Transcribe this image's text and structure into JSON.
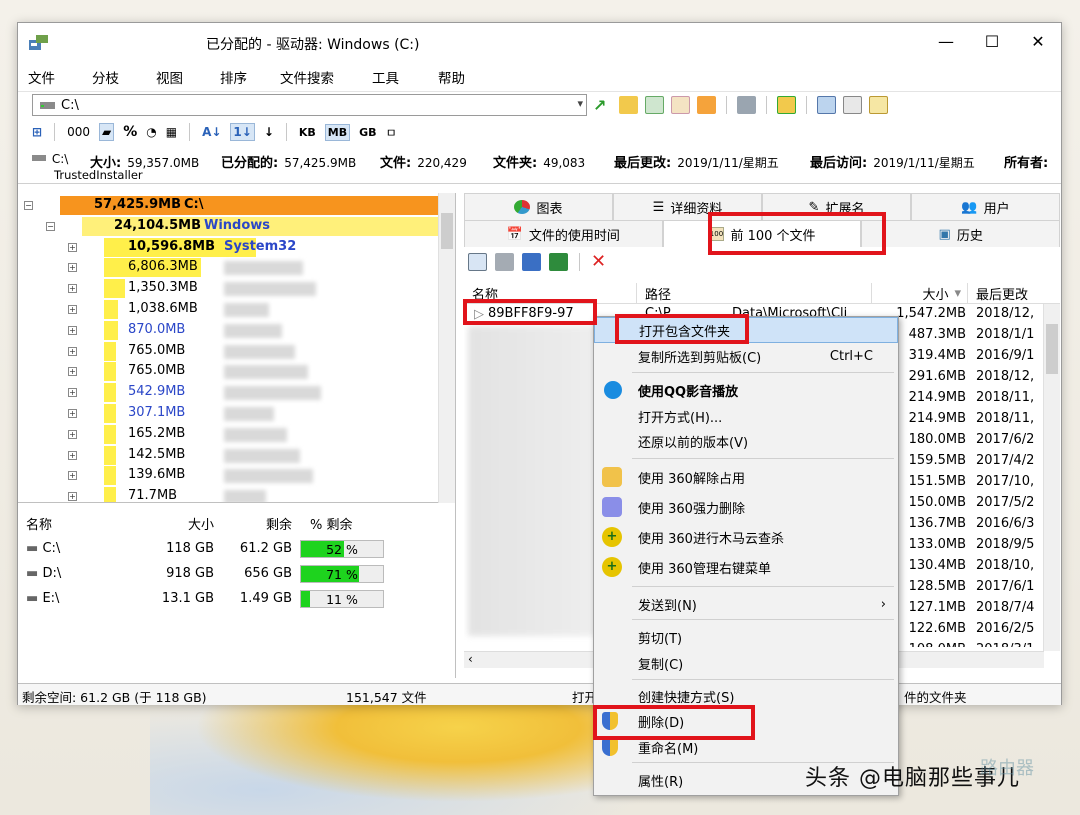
{
  "window": {
    "title": "已分配的 - 驱动器: Windows (C:)",
    "controls": [
      "—",
      "☐",
      "✕"
    ]
  },
  "menu": [
    "文件",
    "分枝",
    "视图",
    "排序",
    "文件搜索",
    "工具",
    "帮助"
  ],
  "address": {
    "value": "C:\\"
  },
  "toolbar2": {
    "labels": [
      "000",
      "%",
      "KB",
      "MB",
      "GB"
    ]
  },
  "info": {
    "drive": "C:\\",
    "size_label": "大小:",
    "size_value": "59,357.0MB",
    "alloc_label": "已分配的:",
    "alloc_value": "57,425.9MB",
    "files_label": "文件:",
    "files_value": "220,429",
    "folders_label": "文件夹:",
    "folders_value": "49,083",
    "modified_label": "最后更改:",
    "modified_value": "2019/1/11/星期五",
    "access_label": "最后访问:",
    "access_value": "2019/1/11/星期五",
    "owner_label": "所有者:",
    "owner_value": "TrustedInstaller"
  },
  "tree": [
    {
      "size": "57,425.9MB",
      "name": "C:\\",
      "level": 0,
      "fill": 1.0,
      "color": "#f7941e"
    },
    {
      "size": "24,104.5MB",
      "name": "Windows",
      "level": 1,
      "fill": 1.0,
      "color": "#fff07a"
    },
    {
      "size": "10,596.8MB",
      "name": "System32",
      "level": 2,
      "fill": 0.44,
      "color": "#ffef4a"
    },
    {
      "size": "6,806.3MB",
      "name": "",
      "level": 2,
      "fill": 0.28,
      "color": "#ffef4a"
    },
    {
      "size": "1,350.3MB",
      "name": "",
      "level": 2,
      "fill": 0.06,
      "color": "#ffef4a"
    },
    {
      "size": "1,038.6MB",
      "name": "",
      "level": 2,
      "fill": 0.04,
      "color": "#ffef4a"
    },
    {
      "size": "870.0MB",
      "name": "",
      "level": 2,
      "fill": 0.04,
      "color": "#ffef4a"
    },
    {
      "size": "765.0MB",
      "name": "",
      "level": 2,
      "fill": 0.03,
      "color": "#ffef4a"
    },
    {
      "size": "765.0MB",
      "name": "",
      "level": 2,
      "fill": 0.03,
      "color": "#ffef4a"
    },
    {
      "size": "542.9MB",
      "name": "",
      "level": 2,
      "fill": 0.02,
      "color": "#ffef4a"
    },
    {
      "size": "307.1MB",
      "name": "",
      "level": 2,
      "fill": 0.01,
      "color": "#ffef4a"
    },
    {
      "size": "165.2MB",
      "name": "",
      "level": 2,
      "fill": 0.01,
      "color": "#ffef4a"
    },
    {
      "size": "142.5MB",
      "name": "",
      "level": 2,
      "fill": 0.01,
      "color": "#ffef4a"
    },
    {
      "size": "139.6MB",
      "name": "",
      "level": 2,
      "fill": 0.01,
      "color": "#ffef4a"
    },
    {
      "size": "71.7MB",
      "name": "",
      "level": 2,
      "fill": 0.0,
      "color": "#ffef4a"
    }
  ],
  "drives": {
    "headers": [
      "名称",
      "大小",
      "剩余",
      "% 剩余"
    ],
    "rows": [
      {
        "name": "C:\\",
        "size": "118 GB",
        "free": "61.2 GB",
        "pct": 0.52,
        "pct_text": "52 %"
      },
      {
        "name": "D:\\",
        "size": "918 GB",
        "free": "656 GB",
        "pct": 0.71,
        "pct_text": "71 %"
      },
      {
        "name": "E:\\",
        "size": "13.1 GB",
        "free": "1.49 GB",
        "pct": 0.11,
        "pct_text": "11 %"
      }
    ]
  },
  "status": {
    "free": "剩余空间: 61.2 GB  (于 118 GB)",
    "count": "151,547  文件",
    "open_text": "打开",
    "parent_text": "件的文件夹"
  },
  "tabs_row1": [
    "图表",
    "详细资料",
    "扩展名",
    "用户"
  ],
  "tabs_row2": [
    "文件的使用时间",
    "前 100 个文件",
    "历史"
  ],
  "list": {
    "headers": [
      "名称",
      "路径",
      "大小",
      "最后更改"
    ],
    "first_name": "89BFF8F9-97",
    "first_path": "C:\\P",
    "first_path2": "Data\\Microsoft\\Cli",
    "rows": [
      {
        "size": "1,547.2MB",
        "date": "2018/12,"
      },
      {
        "size": "487.3MB",
        "date": "2018/1/1"
      },
      {
        "size": "319.4MB",
        "date": "2016/9/1"
      },
      {
        "size": "291.6MB",
        "date": "2018/12,"
      },
      {
        "size": "214.9MB",
        "date": "2018/11,"
      },
      {
        "size": "214.9MB",
        "date": "2018/11,"
      },
      {
        "size": "180.0MB",
        "date": "2017/6/2"
      },
      {
        "size": "159.5MB",
        "date": "2017/4/2"
      },
      {
        "size": "151.5MB",
        "date": "2017/10,"
      },
      {
        "size": "150.0MB",
        "date": "2017/5/2"
      },
      {
        "size": "136.7MB",
        "date": "2016/6/3"
      },
      {
        "size": "133.0MB",
        "date": "2018/9/5"
      },
      {
        "size": "130.4MB",
        "date": "2018/10,"
      },
      {
        "size": "128.5MB",
        "date": "2017/6/1"
      },
      {
        "size": "127.1MB",
        "date": "2018/7/4"
      },
      {
        "size": "122.6MB",
        "date": "2016/2/5"
      },
      {
        "size": "108.0MB",
        "date": "2018/3/1"
      }
    ]
  },
  "context_menu": {
    "open_folder": "打开包含文件夹",
    "copy_path": "复制所选到剪贴板(C)",
    "copy_shortcut": "Ctrl+C",
    "qq_play": "使用QQ影音播放",
    "open_with": "打开方式(H)...",
    "restore": "还原以前的版本(V)",
    "unlock360": "使用 360解除占用",
    "force_delete": "使用 360强力删除",
    "trojan_scan": "使用 360进行木马云查杀",
    "manage_menu": "使用 360管理右键菜单",
    "send_to": "发送到(N)",
    "cut": "剪切(T)",
    "copy": "复制(C)",
    "create_shortcut": "创建快捷方式(S)",
    "delete": "删除(D)",
    "rename": "重命名(M)",
    "properties": "属性(R)"
  },
  "watermark": "头条 @电脑那些事儿",
  "watermark2": "路由器"
}
